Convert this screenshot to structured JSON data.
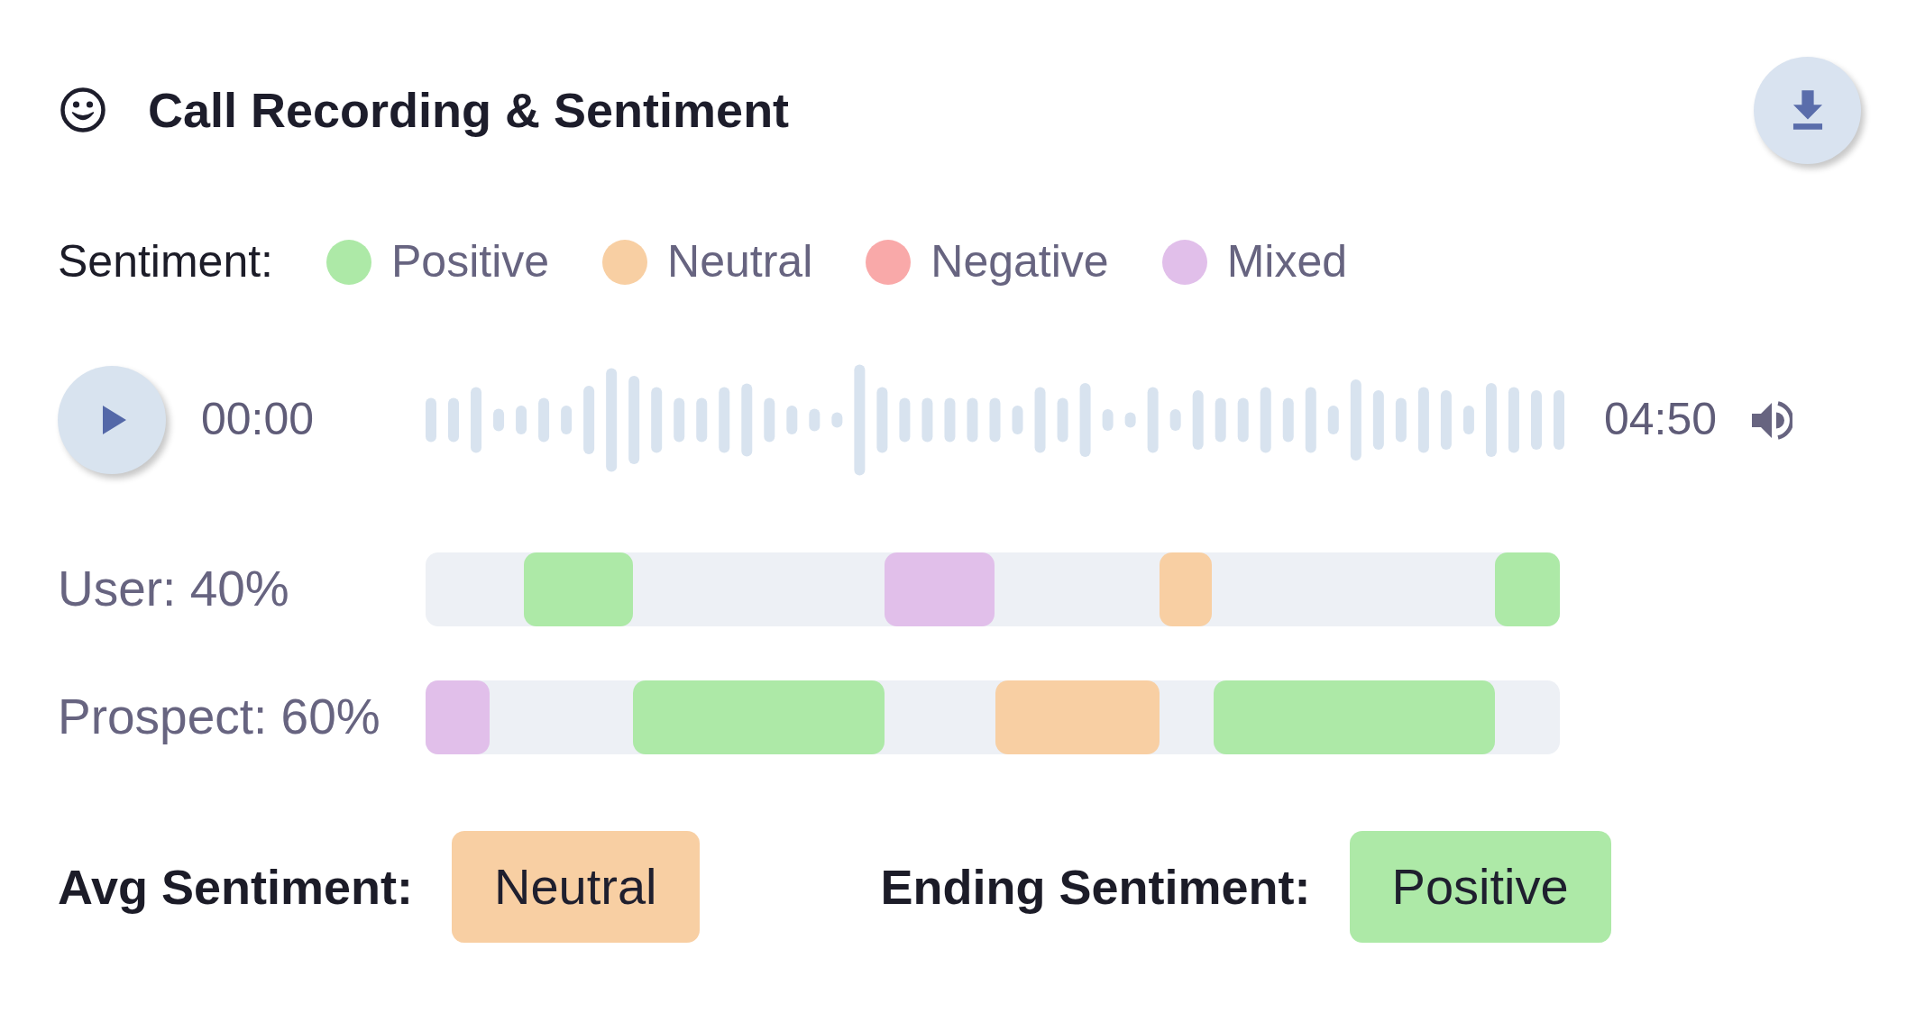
{
  "header": {
    "title": "Call Recording & Sentiment"
  },
  "legend": {
    "label": "Sentiment:",
    "items": [
      {
        "label": "Positive",
        "color": "#ade9a7"
      },
      {
        "label": "Neutral",
        "color": "#f8cfa3"
      },
      {
        "label": "Negative",
        "color": "#f9a9a9"
      },
      {
        "label": "Mixed",
        "color": "#e1bfea"
      }
    ]
  },
  "player": {
    "current_time": "00:00",
    "duration": "04:50"
  },
  "tracks": [
    {
      "label": "User: 40%",
      "segments": [
        {
          "color": "#ade9a7"
        },
        {
          "color": "#e1bfea"
        },
        {
          "color": "#f8cfa3"
        },
        {
          "color": "#ade9a7"
        }
      ]
    },
    {
      "label": "Prospect: 60%",
      "segments": [
        {
          "color": "#e1bfea"
        },
        {
          "color": "#ade9a7"
        },
        {
          "color": "#f8cfa3"
        },
        {
          "color": "#ade9a7"
        }
      ]
    }
  ],
  "summary": [
    {
      "label": "Avg Sentiment:",
      "value": "Neutral",
      "color": "#f8cfa3"
    },
    {
      "label": "Ending Sentiment:",
      "value": "Positive",
      "color": "#ade9a7"
    }
  ]
}
